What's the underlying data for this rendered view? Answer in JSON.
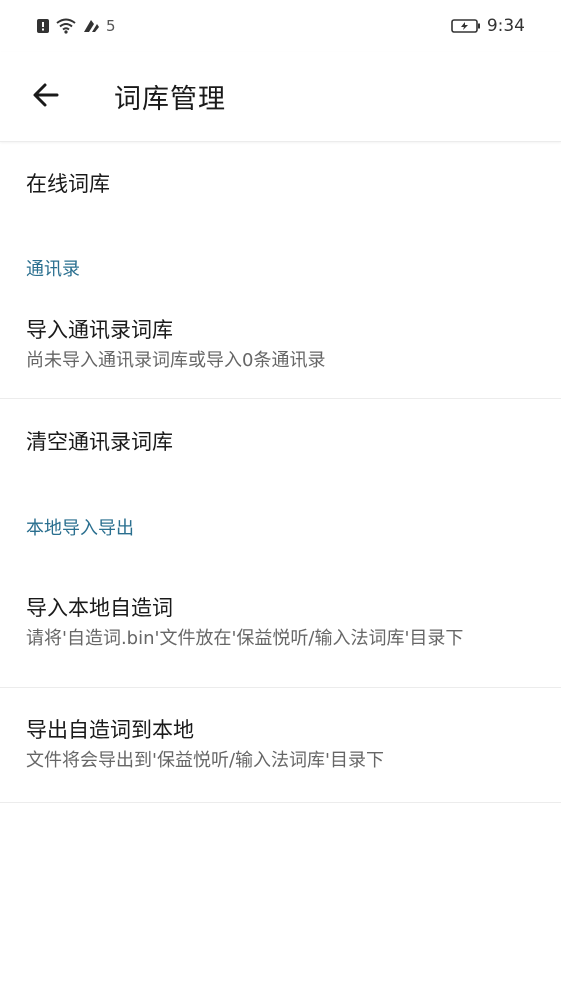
{
  "status_bar": {
    "sim_number": "5",
    "time": "9:34"
  },
  "app_bar": {
    "title": "词库管理",
    "back_icon": "arrow-left-icon"
  },
  "items": {
    "online": {
      "title": "在线词库"
    },
    "contacts_section": {
      "header": "通讯录"
    },
    "import_contacts": {
      "title": "导入通讯录词库",
      "summary": "尚未导入通讯录词库或导入0条通讯录"
    },
    "clear_contacts": {
      "title": "清空通讯录词库"
    },
    "local_section": {
      "header": "本地导入导出"
    },
    "import_local": {
      "title": "导入本地自造词",
      "summary": "请将'自造词.bin'文件放在'保益悦听/输入法词库'目录下"
    },
    "export_local": {
      "title": "导出自造词到本地",
      "summary": "文件将会导出到'保益悦听/输入法词库'目录下"
    }
  },
  "colors": {
    "section_header": "#2a6f8f",
    "divider": "#ececec",
    "text_primary": "#1a1a1a",
    "text_secondary": "#666666"
  }
}
